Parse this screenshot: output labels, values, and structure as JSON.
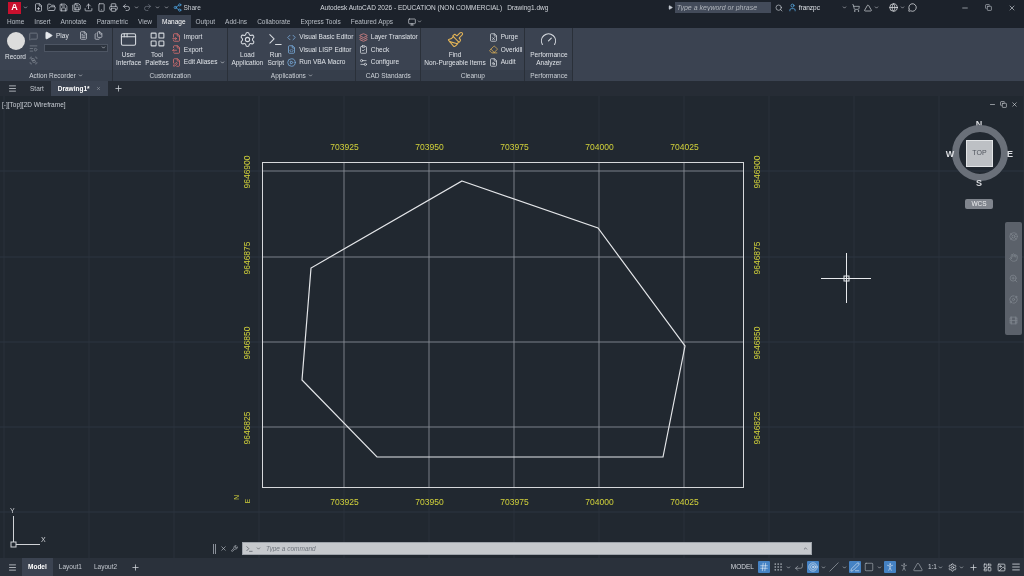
{
  "title_bar": {
    "logo": "A",
    "share": "Share",
    "title": "Autodesk AutoCAD 2026 - EDUCATION (NON COMMERCIAL)",
    "file": "Drawing1.dwg",
    "search": {
      "placeholder": "Type a keyword or phrase"
    },
    "user": "franzpc"
  },
  "ribbon_tabs": [
    {
      "label": "Home",
      "selected": false
    },
    {
      "label": "Insert",
      "selected": false
    },
    {
      "label": "Annotate",
      "selected": false
    },
    {
      "label": "Parametric",
      "selected": false
    },
    {
      "label": "View",
      "selected": false
    },
    {
      "label": "Manage",
      "selected": true
    },
    {
      "label": "Output",
      "selected": false
    },
    {
      "label": "Add-ins",
      "selected": false
    },
    {
      "label": "Collaborate",
      "selected": false
    },
    {
      "label": "Express Tools",
      "selected": false
    },
    {
      "label": "Featured Apps",
      "selected": false
    }
  ],
  "ribbon_panels": [
    {
      "title": "Action Recorder",
      "menu": true,
      "tools": [
        {
          "kind": "large",
          "label": "Record"
        },
        {
          "kind": "icons"
        },
        {
          "kind": "recorder",
          "label": "Play"
        }
      ]
    },
    {
      "title": "Customization",
      "menu": false,
      "tools": [
        {
          "kind": "large",
          "label": "User\nInterface"
        },
        {
          "kind": "large",
          "label": "Tool\nPalettes"
        },
        {
          "kind": "stack",
          "items": [
            {
              "label": "Import",
              "menu": false
            },
            {
              "label": "Export",
              "menu": false
            },
            {
              "label": "Edit Aliases",
              "menu": true
            }
          ]
        }
      ]
    },
    {
      "title": "Applications",
      "menu": true,
      "tools": [
        {
          "kind": "large",
          "label": "Load\nApplication"
        },
        {
          "kind": "large",
          "label": "Run\nScript"
        },
        {
          "kind": "stack",
          "items": [
            {
              "label": "Visual Basic Editor",
              "menu": false
            },
            {
              "label": "Visual LISP Editor",
              "menu": false
            },
            {
              "label": "Run VBA Macro",
              "menu": false
            }
          ]
        }
      ]
    },
    {
      "title": "CAD Standards",
      "menu": false,
      "tools": [
        {
          "kind": "stack",
          "items": [
            {
              "label": "Layer Translator",
              "menu": false
            },
            {
              "label": "Check",
              "menu": false
            },
            {
              "label": "Configure",
              "menu": false
            }
          ]
        }
      ]
    },
    {
      "title": "Cleanup",
      "menu": false,
      "tools": [
        {
          "kind": "large",
          "label": "Find\nNon-Purgeable Items"
        },
        {
          "kind": "stack",
          "items": [
            {
              "label": "Purge",
              "menu": false
            },
            {
              "label": "Overkill",
              "menu": false
            },
            {
              "label": "Audit",
              "menu": false
            }
          ]
        }
      ]
    },
    {
      "title": "Performance",
      "menu": false,
      "tools": [
        {
          "kind": "large",
          "label": "Performance\nAnalyzer"
        }
      ]
    }
  ],
  "document_tabs": [
    {
      "label": "Start",
      "selected": false
    },
    {
      "label": "Drawing1*",
      "selected": true
    }
  ],
  "viewport": {
    "label": "[-][Top][2D Wireframe]",
    "viewcube": {
      "face": "TOP",
      "north": "N",
      "east": "E",
      "south": "S",
      "west": "W",
      "ucs": "WCS"
    }
  },
  "drawing": {
    "top_labels": [
      "703925",
      "703950",
      "703975",
      "704000",
      "704025"
    ],
    "bottom_labels": [
      "703925",
      "703950",
      "703975",
      "704000",
      "704025"
    ],
    "left_labels": [
      "9646900",
      "9646875",
      "9646850",
      "9646825"
    ],
    "right_labels": [
      "9646900",
      "9646875",
      "9646850",
      "9646825"
    ],
    "north_mark": "N",
    "east_mark": "E"
  },
  "ucs_icon": {
    "x_axis": "X",
    "y_axis": "Y"
  },
  "command_line": {
    "placeholder": "Type a command"
  },
  "layout_tabs": [
    {
      "label": "Model",
      "selected": true
    },
    {
      "label": "Layout1",
      "selected": false
    },
    {
      "label": "Layout2",
      "selected": false
    }
  ],
  "status_bar": {
    "space": "MODEL",
    "toggles": [
      {
        "kind": "grid",
        "on": true
      },
      {
        "kind": "snap",
        "on": false
      },
      {
        "kind": "ortho",
        "on": false
      },
      {
        "kind": "polar",
        "on": true
      },
      {
        "kind": "isodraft",
        "on": false
      },
      {
        "kind": "tracking",
        "on": true
      },
      {
        "kind": "selection",
        "on": false
      },
      {
        "kind": "annotation",
        "on": true
      },
      {
        "kind": "visibility",
        "on": false
      },
      {
        "kind": "autoscale",
        "on": false
      }
    ],
    "scale": "1:1"
  }
}
